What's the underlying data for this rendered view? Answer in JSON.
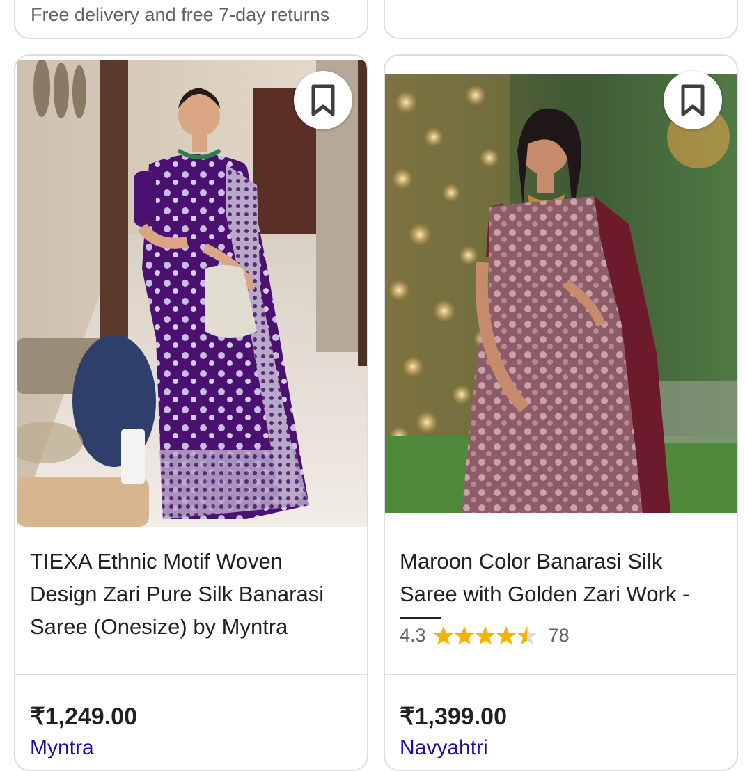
{
  "top_left_card": {
    "text": "Free delivery and free 7-day returns"
  },
  "products": [
    {
      "title": "TIEXA Ethnic Motif Woven Design Zari Pure Silk Banarasi Saree (Onesize) by Myntra",
      "price": "₹1,249.00",
      "merchant": "Myntra",
      "image_icon": "saree-photo-purple"
    },
    {
      "title": "Maroon Color Banarasi Silk Saree with Golden Zari Work -",
      "rating": "4.3",
      "stars": 4.5,
      "reviews": "78",
      "price": "₹1,399.00",
      "merchant": "Navyahtri",
      "image_icon": "saree-photo-maroon"
    }
  ],
  "colors": {
    "star": "#f4b400",
    "link": "#1a0dab",
    "border": "#dadce0"
  },
  "icons": {
    "bookmark": "bookmark-icon",
    "star": "star-icon"
  }
}
